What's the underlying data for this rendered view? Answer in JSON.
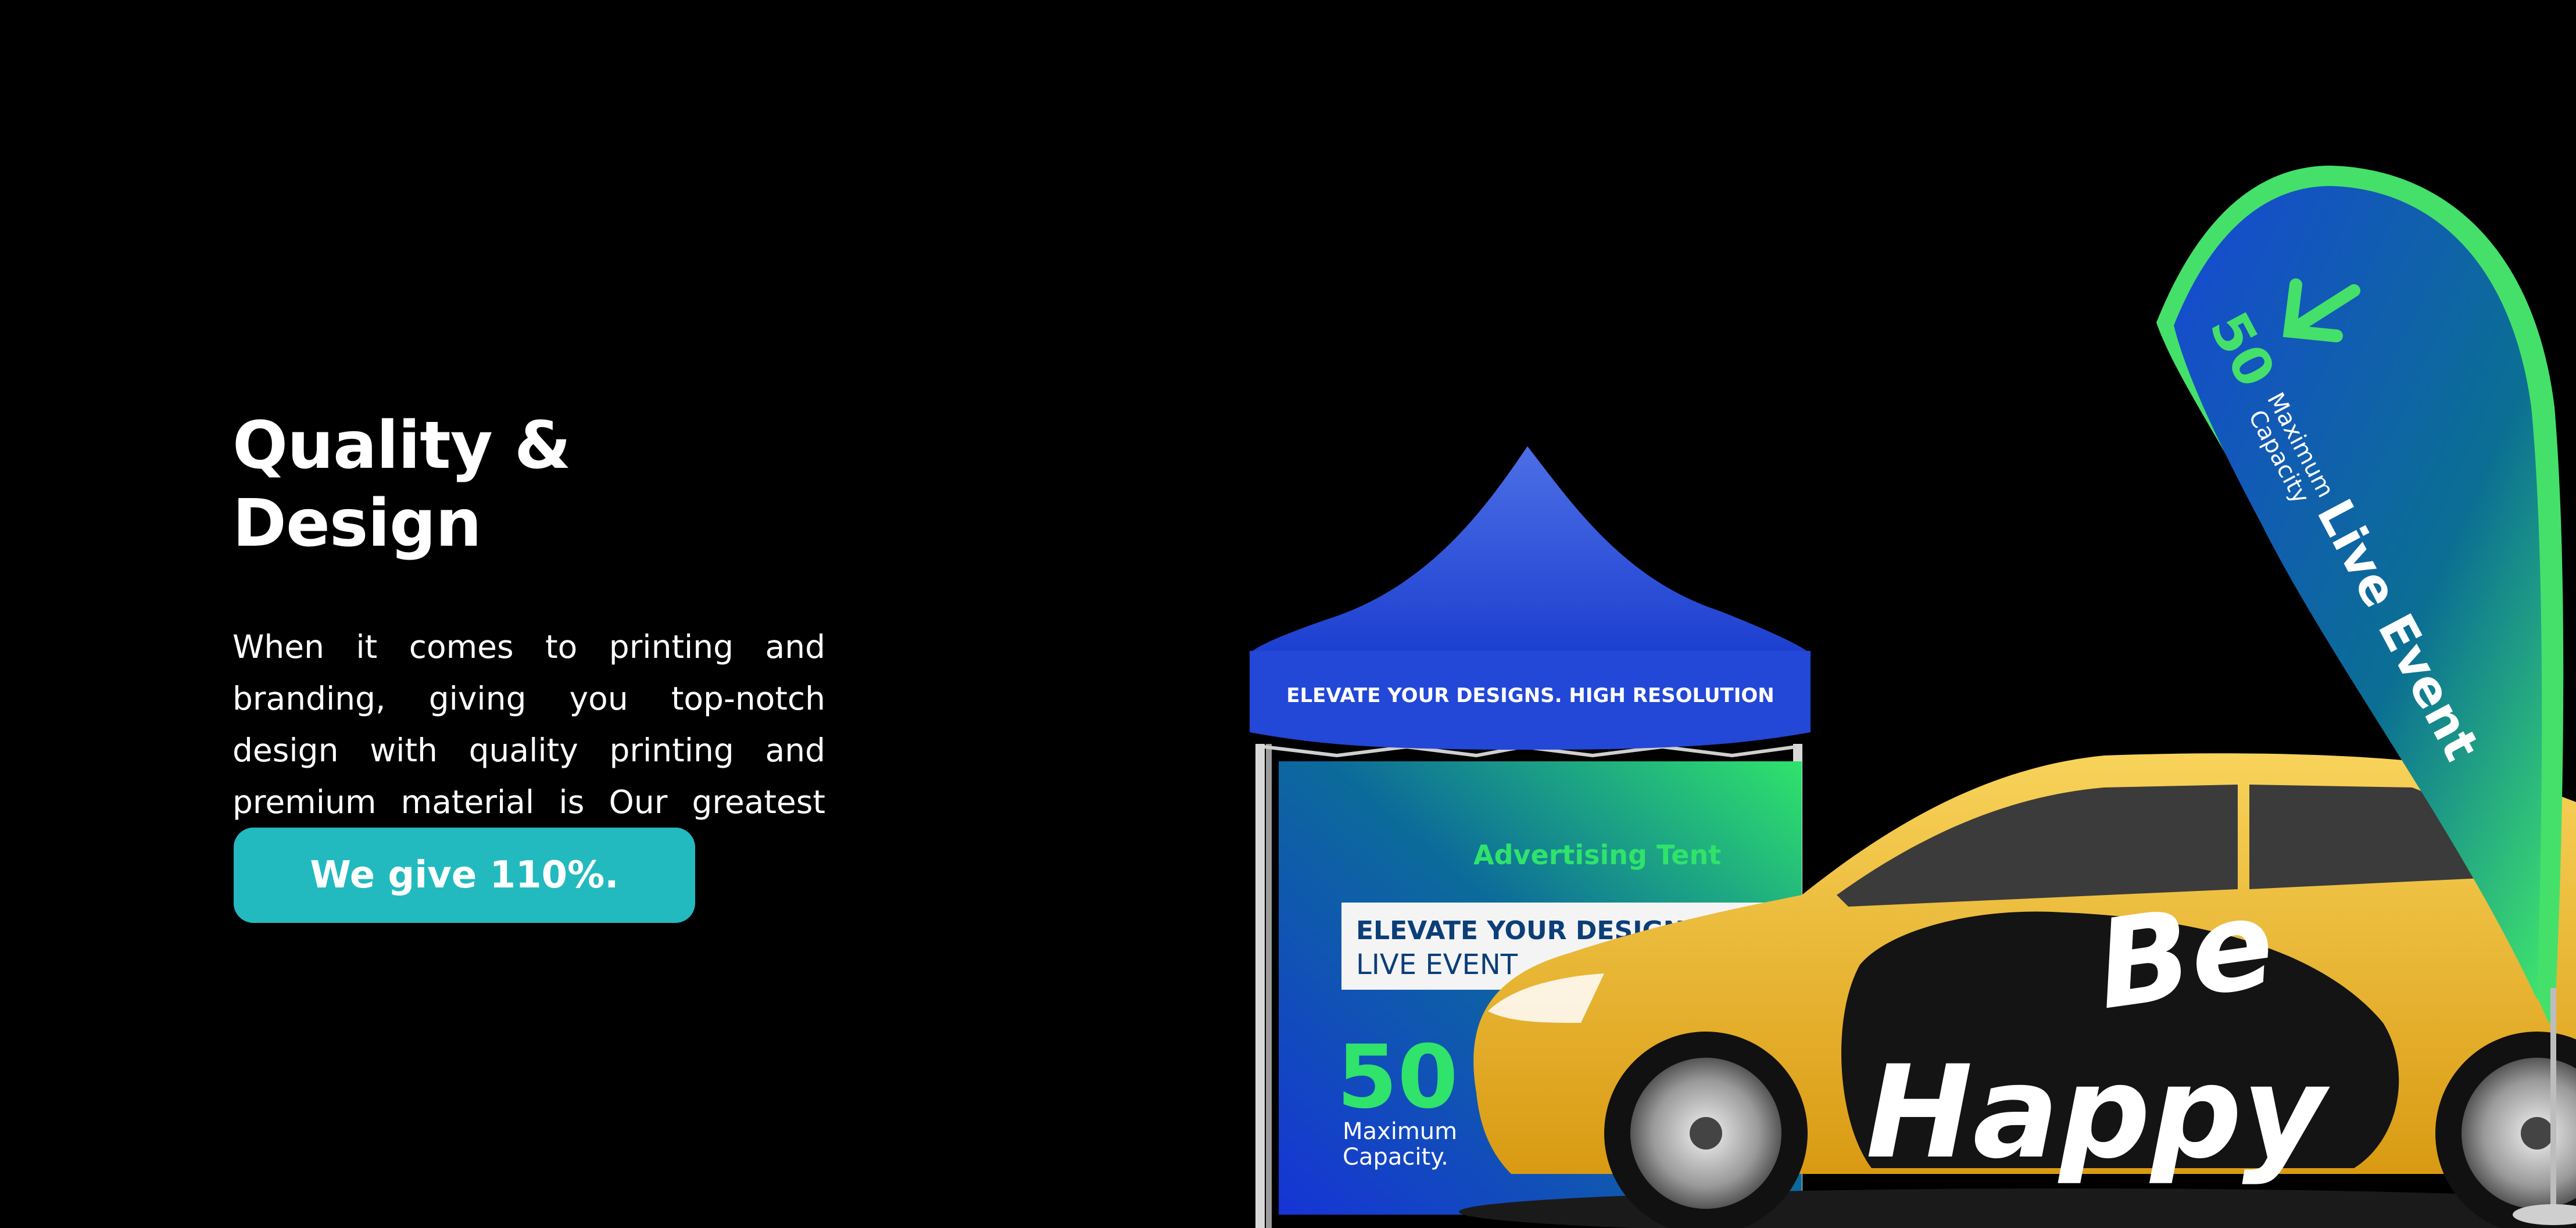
{
  "hero": {
    "title": "Quality & Design",
    "body": "When it comes to printing and branding, giving you top-notch design with quality printing and premium material  is Our greatest priority .",
    "cta_label": "We give 110%.",
    "cta_color": "#22babf"
  },
  "tent": {
    "canopy_text": "ELEVATE YOUR DESIGNS. HIGH RESOLUTION",
    "panel_heading": "Advertising Tent",
    "panel_line1": "ELEVATE YOUR DESIGNS",
    "panel_line2": "LIVE EVENT",
    "capacity_number": "50",
    "capacity_label_1": "Maximum",
    "capacity_label_2": "Capacity.",
    "canopy_color": "#2448d8",
    "accent_green": "#2fe36b"
  },
  "flag": {
    "capacity_number": "50",
    "capacity_label_1": "Maximum",
    "capacity_label_2": "Capacity",
    "event_text": "Live Event",
    "arrow_icon": "arrow-down-left-icon"
  },
  "car": {
    "wrap_line1": "Be",
    "wrap_line2": "Happy",
    "body_color": "#f3bf2a"
  }
}
